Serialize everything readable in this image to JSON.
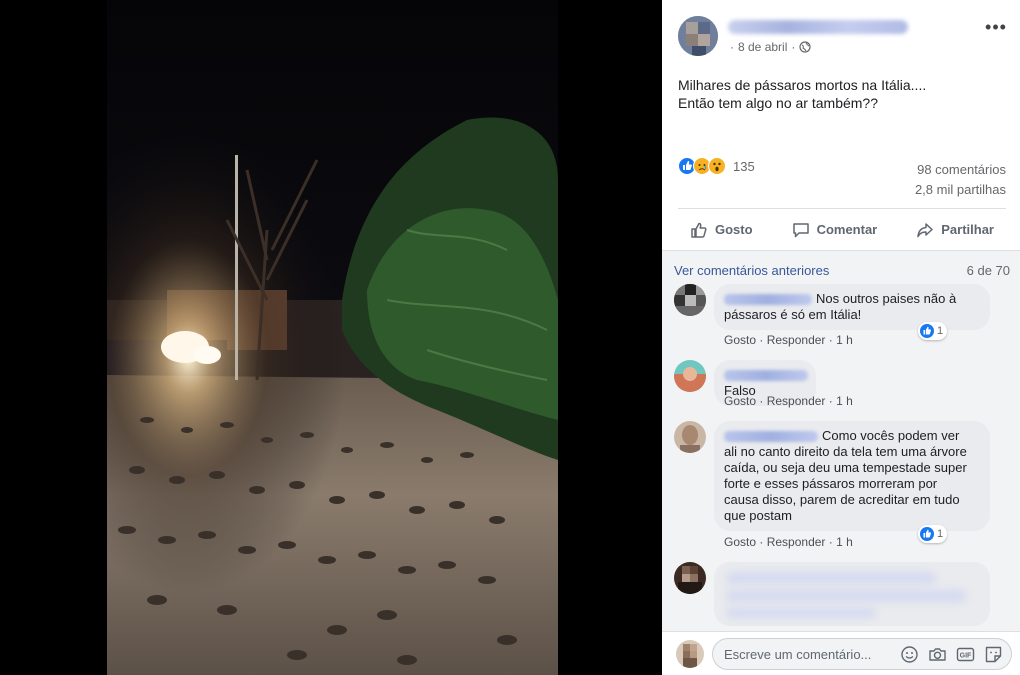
{
  "post": {
    "date": "8 de abril",
    "separator": "·",
    "text_lines": [
      "Milhares de pássaros mortos na Itália....",
      "Então tem algo no ar também??"
    ],
    "reaction_count": "135",
    "comments_count": "98 comentários",
    "shares_count": "2,8 mil partilhas"
  },
  "actions": {
    "like": "Gosto",
    "comment": "Comentar",
    "share": "Partilhar"
  },
  "comments_section": {
    "previous_link": "Ver comentários anteriores",
    "count": "6 de 70"
  },
  "comments": [
    {
      "line1": "Nos outros paises não à",
      "line2": "pássaros é só em Itália!",
      "like": "Gosto",
      "reply": "Responder",
      "time": "1 h",
      "reactions": "1"
    },
    {
      "text": "Falso",
      "like": "Gosto",
      "reply": "Responder",
      "time": "1 h"
    },
    {
      "lines": [
        "Como vocês podem ver",
        "ali no canto direito da tela tem uma árvore",
        "caída, ou seja deu uma tempestade super",
        "forte e esses pássaros morreram por",
        "causa disso, parem de acreditar em tudo",
        "que postam"
      ],
      "like": "Gosto",
      "reply": "Responder",
      "time": "1 h",
      "reactions": "1"
    }
  ],
  "composer": {
    "placeholder": "Escreve um comentário..."
  },
  "meta_sep": "·",
  "icons": [
    "globe-icon",
    "more-icon",
    "like-icon",
    "comment-icon",
    "share-icon",
    "emoji-icon",
    "camera-icon",
    "gif-icon",
    "sticker-icon"
  ],
  "colors": {
    "accent": "#1877f2",
    "link": "#385898",
    "muted": "#65676b"
  }
}
